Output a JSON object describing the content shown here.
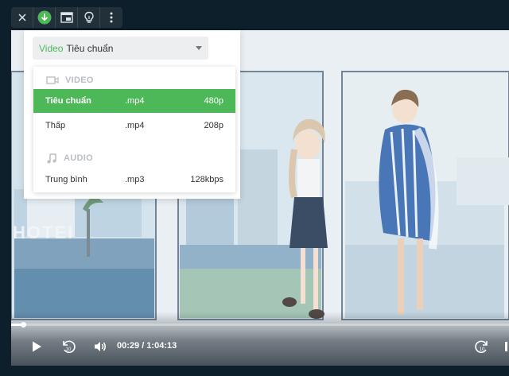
{
  "toolbar": {
    "buttons": [
      {
        "icon": "close-icon"
      },
      {
        "icon": "download-icon",
        "color": "#4db858"
      },
      {
        "icon": "picture-in-picture-icon"
      },
      {
        "icon": "lightbulb-icon"
      },
      {
        "icon": "more-vertical-icon"
      }
    ]
  },
  "quality_panel": {
    "select_prefix": "Video",
    "select_value": "Tiêu chuẩn",
    "video_header": "VIDEO",
    "audio_header": "AUDIO",
    "video_options": [
      {
        "quality": "Tiêu chuẩn",
        "format": ".mp4",
        "resolution": "480p",
        "selected": true
      },
      {
        "quality": "Thấp",
        "format": ".mp4",
        "resolution": "208p",
        "selected": false
      }
    ],
    "audio_options": [
      {
        "quality": "Trung bình",
        "format": ".mp3",
        "bitrate": "128kbps"
      }
    ],
    "accent_color": "#4db858"
  },
  "scene": {
    "hotel_sign": "HOTEI"
  },
  "player": {
    "current_time": "00:29",
    "separator": "/",
    "duration": "1:04:13",
    "time_display": "00:29 / 1:04:13",
    "progress_fraction": 0.0075,
    "rewind_seconds": "10",
    "forward_seconds": "10"
  }
}
